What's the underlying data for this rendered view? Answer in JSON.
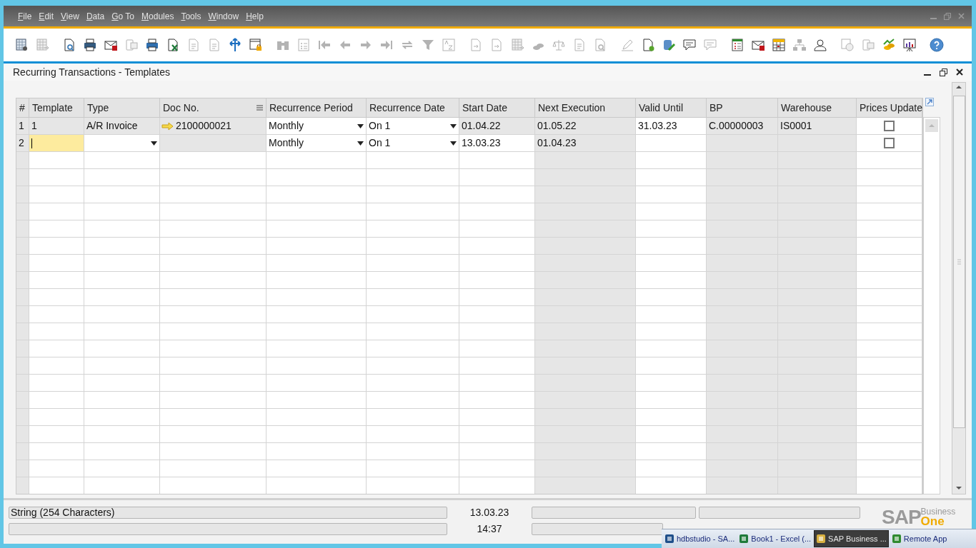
{
  "menu": [
    {
      "label": "File"
    },
    {
      "label": "Edit"
    },
    {
      "label": "View"
    },
    {
      "label": "Data"
    },
    {
      "label": "Go To"
    },
    {
      "label": "Modules"
    },
    {
      "label": "Tools"
    },
    {
      "label": "Window"
    },
    {
      "label": "Help"
    }
  ],
  "toolbar_groups": [
    {
      "buttons": [
        {
          "disabled": false
        },
        {
          "disabled": true
        }
      ]
    },
    {
      "buttons": [
        {
          "disabled": false
        },
        {
          "disabled": false
        },
        {
          "disabled": false
        },
        {
          "disabled": true
        },
        {
          "disabled": false
        },
        {
          "disabled": false
        },
        {
          "disabled": true
        },
        {
          "disabled": true
        },
        {
          "disabled": false
        },
        {
          "disabled": false
        }
      ]
    },
    {
      "buttons": [
        {
          "disabled": true
        },
        {
          "disabled": true
        },
        {
          "disabled": true
        },
        {
          "disabled": true
        },
        {
          "disabled": true
        },
        {
          "disabled": true
        },
        {
          "disabled": true
        },
        {
          "disabled": true
        },
        {
          "disabled": true
        }
      ]
    },
    {
      "buttons": [
        {
          "disabled": true
        },
        {
          "disabled": true
        },
        {
          "disabled": true
        },
        {
          "disabled": true
        },
        {
          "disabled": true
        },
        {
          "disabled": true
        },
        {
          "disabled": true
        }
      ]
    },
    {
      "buttons": [
        {
          "disabled": true
        },
        {
          "disabled": false
        },
        {
          "disabled": false
        },
        {
          "disabled": false
        },
        {
          "disabled": true
        }
      ]
    },
    {
      "buttons": [
        {
          "disabled": false
        },
        {
          "disabled": false
        },
        {
          "disabled": false
        },
        {
          "disabled": true
        },
        {
          "disabled": false
        }
      ]
    },
    {
      "buttons": [
        {
          "disabled": true
        },
        {
          "disabled": true
        },
        {
          "disabled": false
        },
        {
          "disabled": false
        }
      ]
    },
    {
      "buttons": [
        {
          "disabled": false
        }
      ]
    }
  ],
  "form": {
    "title": "Recurring Transactions - Templates"
  },
  "table": {
    "columns": [
      {
        "label": "#",
        "editable": false
      },
      {
        "label": "Template",
        "editable": true
      },
      {
        "label": "Type",
        "editable": true
      },
      {
        "label": "Doc No.",
        "editable": true,
        "menu": true
      },
      {
        "label": "Recurrence Period",
        "editable": true
      },
      {
        "label": "Recurrence Date",
        "editable": true
      },
      {
        "label": "Start Date",
        "editable": true
      },
      {
        "label": "Next Execution",
        "editable": false
      },
      {
        "label": "Valid Until",
        "editable": true
      },
      {
        "label": "BP",
        "editable": false
      },
      {
        "label": "Warehouse",
        "editable": false
      },
      {
        "label": "Prices Update",
        "editable": true
      }
    ],
    "rows": [
      {
        "cells": [
          {
            "kind": "text",
            "value": "1",
            "editable": false
          },
          {
            "kind": "text",
            "value": "1",
            "editable": false
          },
          {
            "kind": "text",
            "value": "A/R Invoice",
            "editable": false
          },
          {
            "kind": "link",
            "value": "2100000021",
            "editable": false
          },
          {
            "kind": "dropdown",
            "value": "Monthly",
            "editable": true
          },
          {
            "kind": "dropdown",
            "value": "On 1",
            "editable": true
          },
          {
            "kind": "text",
            "value": "01.04.22",
            "editable": false
          },
          {
            "kind": "text",
            "value": "01.05.22",
            "editable": false
          },
          {
            "kind": "text",
            "value": "31.03.23",
            "editable": true
          },
          {
            "kind": "text",
            "value": "C.00000003",
            "editable": false
          },
          {
            "kind": "text",
            "value": "IS0001",
            "editable": false
          },
          {
            "kind": "checkbox",
            "checked": false,
            "editable": true
          }
        ]
      },
      {
        "cells": [
          {
            "kind": "text",
            "value": "2",
            "editable": false
          },
          {
            "kind": "input",
            "focused": true
          },
          {
            "kind": "dropdown",
            "editable": true
          },
          {
            "kind": "text",
            "editable": false
          },
          {
            "kind": "dropdown",
            "value": "Monthly",
            "editable": true
          },
          {
            "kind": "dropdown",
            "value": "On 1",
            "editable": true
          },
          {
            "kind": "text",
            "value": "13.03.23",
            "editable": true
          },
          {
            "kind": "text",
            "value": "01.04.23",
            "editable": false
          },
          {
            "kind": "text",
            "editable": true
          },
          {
            "kind": "text",
            "editable": false
          },
          {
            "kind": "text",
            "editable": false
          },
          {
            "kind": "checkbox",
            "checked": false,
            "editable": true
          }
        ]
      }
    ]
  },
  "status_bar": {
    "message": "String (254 Characters)",
    "date": "13.03.23",
    "time": "14:37"
  },
  "logo": {
    "brand": "SAP",
    "line_1": "Business",
    "line_2": "One"
  },
  "taskbar": [
    {
      "label": "hdbstudio - SA...",
      "selected": false
    },
    {
      "label": "Book1 - Excel (...",
      "selected": false
    },
    {
      "label": "SAP Business ...",
      "selected": true
    },
    {
      "label": "Remote App",
      "selected": false
    }
  ]
}
